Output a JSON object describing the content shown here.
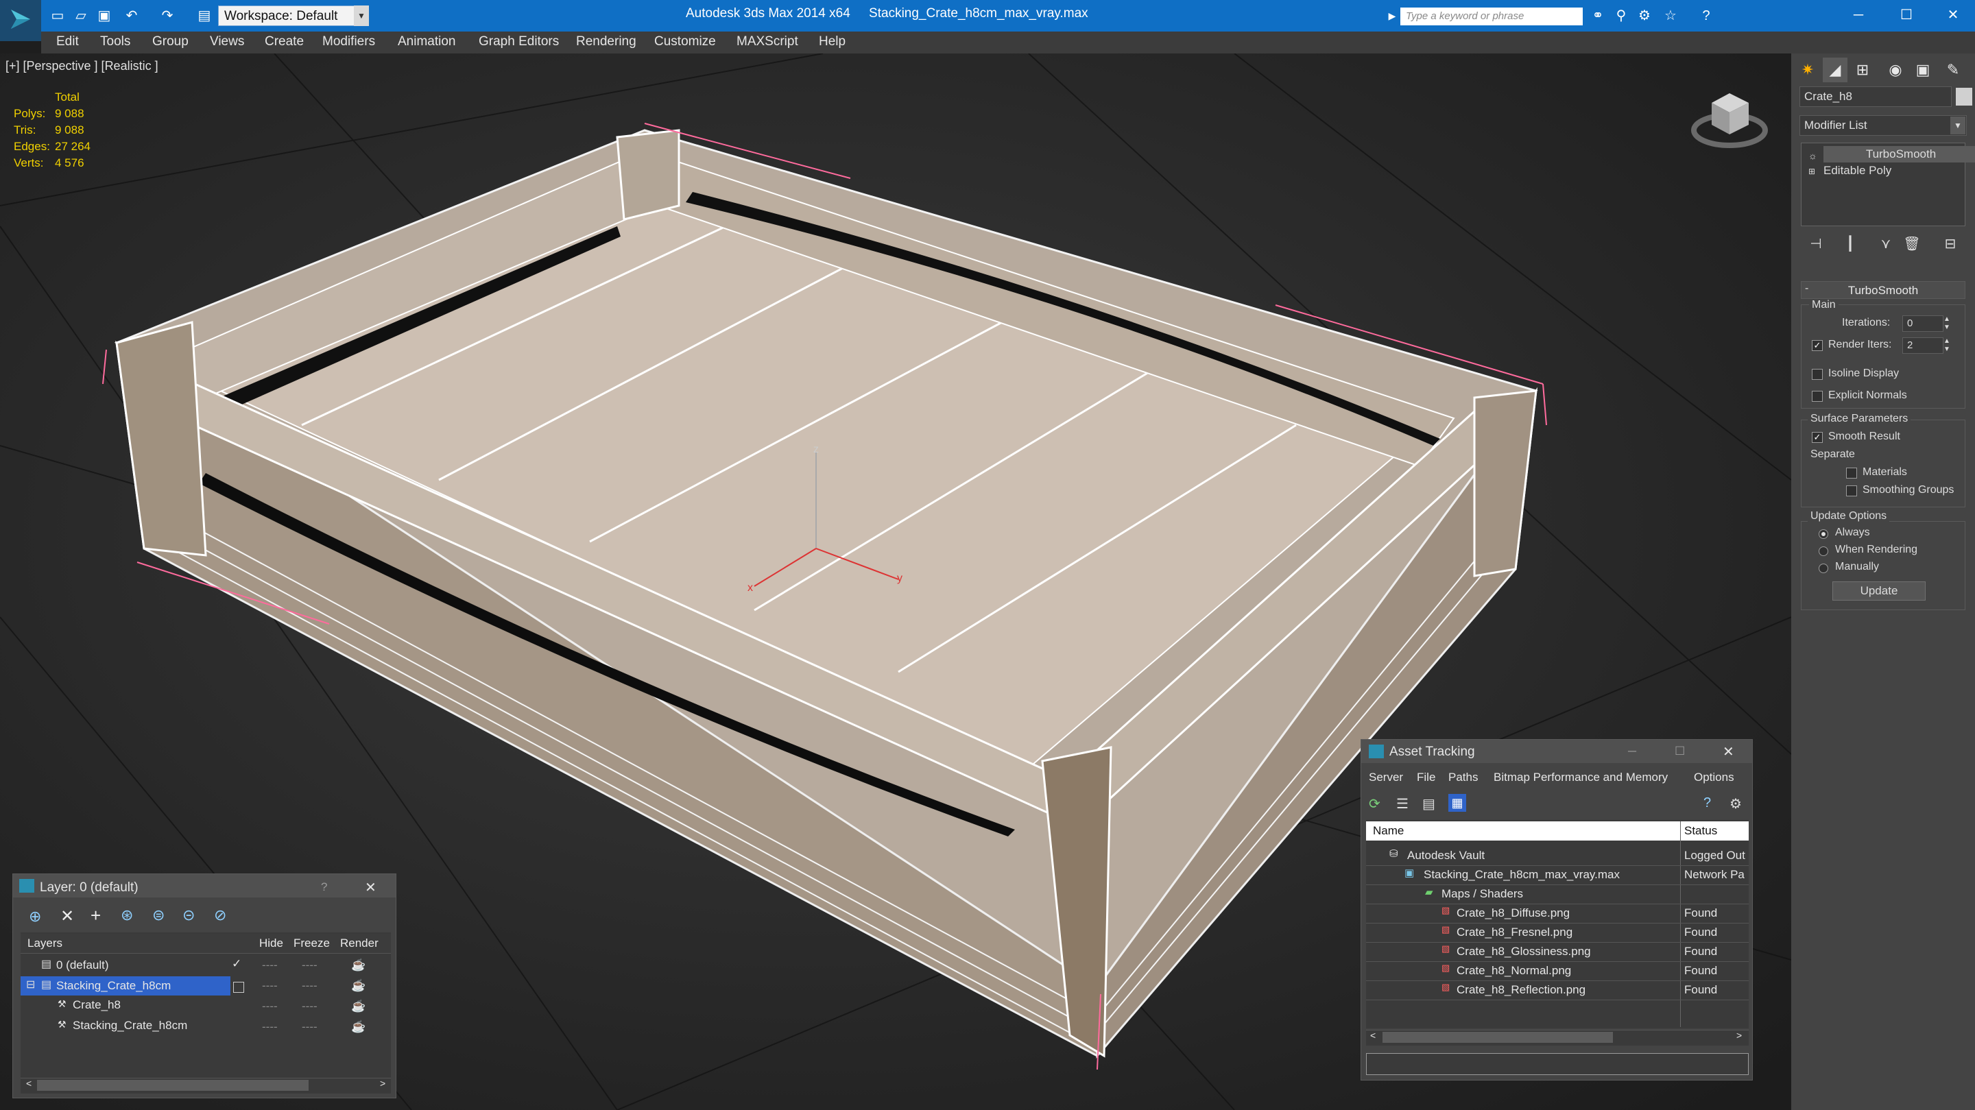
{
  "window": {
    "title_app": "Autodesk 3ds Max  2014 x64",
    "title_file": "Stacking_Crate_h8cm_max_vray.max",
    "workspace_label": "Workspace: Default",
    "search_placeholder": "Type a keyword or phrase",
    "minimize": "─",
    "maximize": "☐",
    "close": "✕"
  },
  "menu": [
    "Edit",
    "Tools",
    "Group",
    "Views",
    "Create",
    "Modifiers",
    "Animation",
    "Graph Editors",
    "Rendering",
    "Customize",
    "MAXScript",
    "Help"
  ],
  "viewport": {
    "label": "[+] [Perspective ] [Realistic ]",
    "stats": {
      "header": "Total",
      "rows": [
        {
          "key": "Polys:",
          "value": "9 088"
        },
        {
          "key": "Tris:",
          "value": "9 088"
        },
        {
          "key": "Edges:",
          "value": "27 264"
        },
        {
          "key": "Verts:",
          "value": "4 576"
        }
      ]
    },
    "axis_labels": {
      "x": "x",
      "y": "y",
      "z": "z"
    }
  },
  "command_panel": {
    "object_name": "Crate_h8",
    "modifier_list": "Modifier List",
    "stack": [
      "TurboSmooth",
      "Editable Poly"
    ],
    "rollout_title": "TurboSmooth",
    "main": {
      "title": "Main",
      "iterations_label": "Iterations:",
      "iterations_value": "0",
      "render_iters_label": "Render Iters:",
      "render_iters_value": "2",
      "render_iters_checked": true,
      "isoline_label": "Isoline Display",
      "explicit_label": "Explicit Normals"
    },
    "surface": {
      "title": "Surface Parameters",
      "smooth_label": "Smooth Result",
      "separate_label": "Separate",
      "materials_label": "Materials",
      "smoothing_label": "Smoothing Groups"
    },
    "update": {
      "title": "Update Options",
      "always": "Always",
      "when_rendering": "When Rendering",
      "manually": "Manually",
      "button": "Update"
    }
  },
  "layer_window": {
    "title": "Layer: 0 (default)",
    "help": "?",
    "close": "✕",
    "columns": {
      "layers": "Layers",
      "hide": "Hide",
      "freeze": "Freeze",
      "render": "Render"
    },
    "rows": [
      {
        "name": "0 (default)"
      },
      {
        "name": "Stacking_Crate_h8cm"
      },
      {
        "name": "Crate_h8"
      },
      {
        "name": "Stacking_Crate_h8cm"
      }
    ]
  },
  "asset_window": {
    "title": "Asset Tracking",
    "menu": [
      "Server",
      "File",
      "Paths",
      "Bitmap Performance and Memory",
      "Options"
    ],
    "columns": {
      "name": "Name",
      "status": "Status"
    },
    "rows": [
      {
        "name": "Autodesk Vault",
        "status": "Logged Out"
      },
      {
        "name": "Stacking_Crate_h8cm_max_vray.max",
        "status": "Network Pa"
      },
      {
        "name": "Maps / Shaders",
        "status": ""
      },
      {
        "name": "Crate_h8_Diffuse.png",
        "status": "Found"
      },
      {
        "name": "Crate_h8_Fresnel.png",
        "status": "Found"
      },
      {
        "name": "Crate_h8_Glossiness.png",
        "status": "Found"
      },
      {
        "name": "Crate_h8_Normal.png",
        "status": "Found"
      },
      {
        "name": "Crate_h8_Reflection.png",
        "status": "Found"
      }
    ]
  },
  "colors": {
    "titlebar": "#0f6fc5",
    "selection": "#2f63c9",
    "stats": "#f0d000",
    "wood": "#cdbfb2"
  }
}
